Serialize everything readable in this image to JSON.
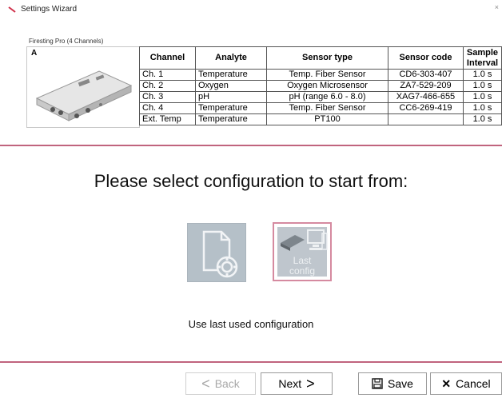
{
  "window": {
    "title": "Settings Wizard"
  },
  "device": {
    "name": "Firesting Pro (4 Channels)",
    "letter": "A"
  },
  "table": {
    "headers": {
      "channel": "Channel",
      "analyte": "Analyte",
      "sensor_type": "Sensor type",
      "sensor_code": "Sensor code",
      "sample_line1": "Sample",
      "sample_line2": "Interval"
    },
    "rows": [
      {
        "channel": "Ch. 1",
        "analyte": "Temperature",
        "sensor_type": "Temp. Fiber Sensor",
        "sensor_code": "CD6-303-407",
        "interval": "1.0 s"
      },
      {
        "channel": "Ch. 2",
        "analyte": "Oxygen",
        "sensor_type": "Oxygen Microsensor",
        "sensor_code": "ZA7-529-209",
        "interval": "1.0 s"
      },
      {
        "channel": "Ch. 3",
        "analyte": "pH",
        "sensor_type": "pH (range 6.0 - 8.0)",
        "sensor_code": "XAG7-466-655",
        "interval": "1.0 s"
      },
      {
        "channel": "Ch. 4",
        "analyte": "Temperature",
        "sensor_type": "Temp. Fiber Sensor",
        "sensor_code": "CC6-269-419",
        "interval": "1.0 s"
      },
      {
        "channel": "Ext. Temp",
        "analyte": "Temperature",
        "sensor_type": "PT100",
        "sensor_code": "",
        "interval": "1.0 s"
      }
    ]
  },
  "main": {
    "prompt": "Please select configuration to start from:",
    "last_config_line1": "Last",
    "last_config_line2": "config",
    "caption": "Use last used configuration"
  },
  "buttons": {
    "back": "Back",
    "next": "Next",
    "save": "Save",
    "cancel": "Cancel"
  },
  "colors": {
    "accent": "#c0647e",
    "tile": "#b5c0c8"
  }
}
